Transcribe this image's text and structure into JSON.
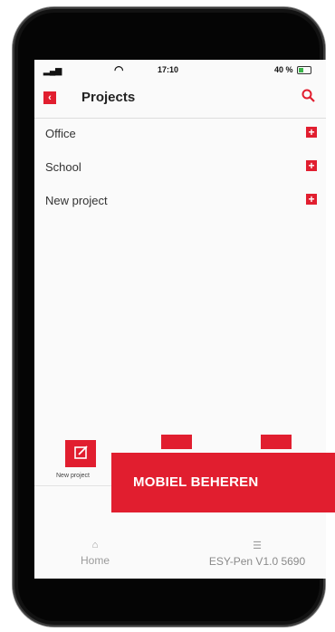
{
  "status_bar": {
    "time": "17:10",
    "battery": "40 %"
  },
  "header": {
    "title": "Projects"
  },
  "projects": [
    {
      "label": "Office"
    },
    {
      "label": "School"
    },
    {
      "label": "New project"
    }
  ],
  "toolbar": {
    "new_project_label": "New project"
  },
  "tabbar": {
    "home_label": "Home",
    "settings_label": "ESY-Pen V1.0 5690"
  },
  "banner": {
    "text": "MOBIEL BEHEREN"
  },
  "colors": {
    "accent": "#e11e2f",
    "phone_frame": "#121212"
  },
  "icons": {
    "back": "chevron-left-icon",
    "search": "search-icon",
    "add": "plus-icon",
    "edit": "edit-icon",
    "home": "home-icon",
    "settings": "sliders-icon"
  }
}
